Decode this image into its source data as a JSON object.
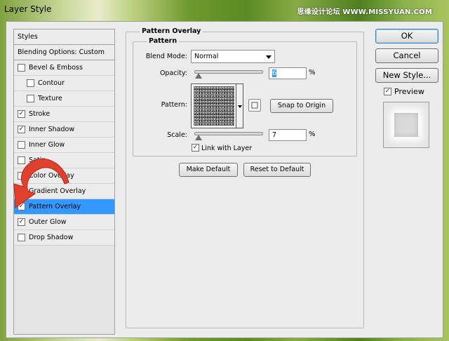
{
  "window": {
    "title": "Layer Style"
  },
  "watermark": {
    "text1": "思缘设计论坛",
    "text2": "WWW.MISSYUAN.COM"
  },
  "styles_list": {
    "header": "Styles",
    "blending_options": "Blending Options: Custom",
    "items": [
      {
        "label": "Bevel & Emboss",
        "checked": false,
        "indent": false
      },
      {
        "label": "Contour",
        "checked": false,
        "indent": true
      },
      {
        "label": "Texture",
        "checked": false,
        "indent": true
      },
      {
        "label": "Stroke",
        "checked": true,
        "indent": false
      },
      {
        "label": "Inner Shadow",
        "checked": true,
        "indent": false
      },
      {
        "label": "Inner Glow",
        "checked": false,
        "indent": false
      },
      {
        "label": "Satin",
        "checked": false,
        "indent": false
      },
      {
        "label": "Color Overlay",
        "checked": false,
        "indent": false
      },
      {
        "label": "Gradient Overlay",
        "checked": false,
        "indent": false
      },
      {
        "label": "Pattern Overlay",
        "checked": true,
        "indent": false,
        "selected": true
      },
      {
        "label": "Outer Glow",
        "checked": true,
        "indent": false
      },
      {
        "label": "Drop Shadow",
        "checked": false,
        "indent": false
      }
    ]
  },
  "pattern_overlay": {
    "section_title": "Pattern Overlay",
    "group_title": "Pattern",
    "blend_mode_label": "Blend Mode:",
    "blend_mode_value": "Normal",
    "opacity_label": "Opacity:",
    "opacity_value": "6",
    "opacity_unit": "%",
    "pattern_label": "Pattern:",
    "snap_button": "Snap to Origin",
    "scale_label": "Scale:",
    "scale_value": "7",
    "scale_unit": "%",
    "link_label": "Link with Layer",
    "link_checked": true,
    "make_default": "Make Default",
    "reset_default": "Reset to Default"
  },
  "side_buttons": {
    "ok": "OK",
    "cancel": "Cancel",
    "new_style": "New Style...",
    "preview_label": "Preview",
    "preview_checked": true
  },
  "check_glyph": "✓",
  "colors": {
    "selection": "#3399ff",
    "dialog_bg": "#ececec",
    "arrow_red": "#e0402e"
  }
}
